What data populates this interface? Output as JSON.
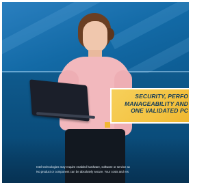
{
  "video_frame": {
    "headline_lines": [
      "SECURITY, PERFO",
      "MANAGEABILITY AND",
      "ONE VALIDATED PC"
    ],
    "disclaimer_lines": [
      "Intel technologies may require enabled hardware, software or service ac",
      "No product or component can be absolutely secure. Your costs and res"
    ],
    "colors": {
      "background_blue": "#0f5a8d",
      "callout_yellow": "#f4c342",
      "callout_text": "#123a58",
      "sweater_pink": "#f2b8bd"
    }
  }
}
